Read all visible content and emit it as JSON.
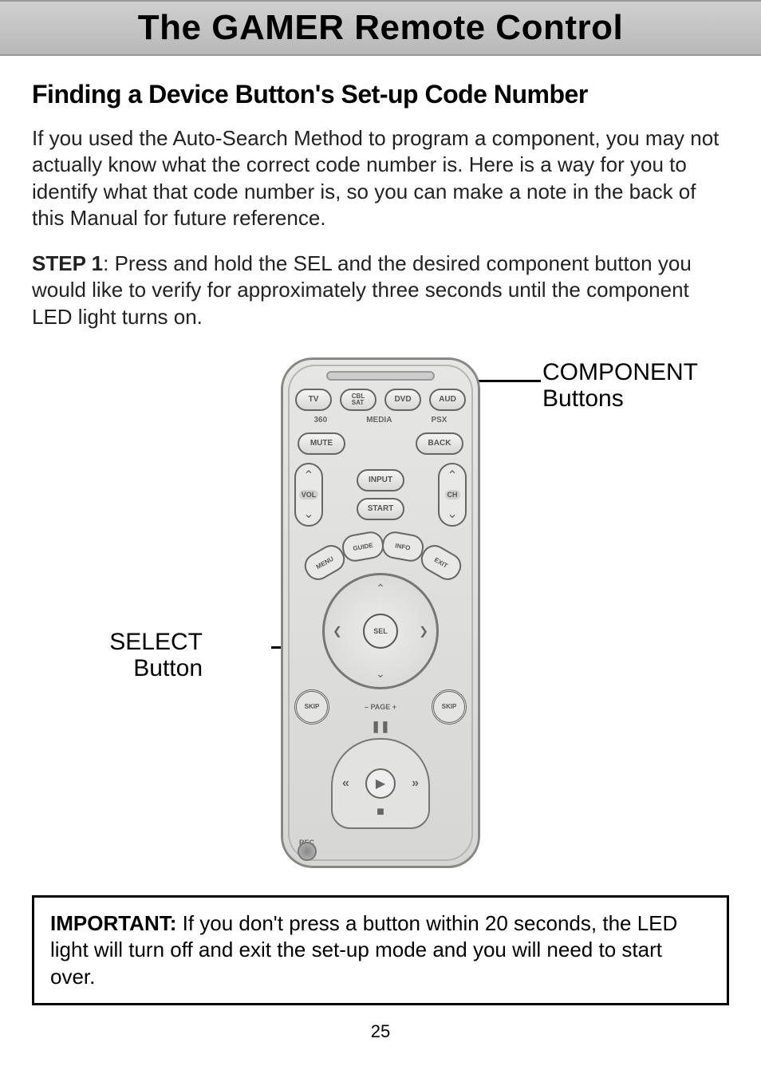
{
  "header": {
    "title": "The GAMER Remote Control"
  },
  "section": {
    "heading": "Finding a Device Button's Set-up Code Number"
  },
  "intro": "If you used the Auto-Search Method to program a component, you may not actually know what the correct code number is. Here is a way for you to identify what that code number is, so you can make a note in the back of this Manual for future reference.",
  "step1": {
    "label": "STEP 1",
    "text": ": Press and hold the SEL and the desired component button you would like to verify for approximately three seconds until the component LED light turns on."
  },
  "callouts": {
    "component_line1": "COMPONENT",
    "component_line2": "Buttons",
    "select_line1": "SELECT",
    "select_line2": "Button"
  },
  "remote": {
    "row1": [
      "TV",
      "CBL SAT",
      "DVD",
      "AUD"
    ],
    "sub1": [
      "360",
      "MEDIA",
      "PSX"
    ],
    "row2": [
      "MUTE",
      "BACK"
    ],
    "center_btns": [
      "INPUT",
      "START"
    ],
    "rocker_left": "VOL",
    "rocker_right": "CH",
    "arc": [
      "MENU",
      "GUIDE",
      "INFO",
      "EXIT"
    ],
    "sel": "SEL",
    "skip_minus": "SKIP",
    "skip_plus": "SKIP",
    "page": "– PAGE +",
    "rec": "REC"
  },
  "important": {
    "label": "IMPORTANT:",
    "text": " If you don't press a button within 20 seconds, the LED light will turn off and exit the set-up mode and you will need to start over."
  },
  "page_number": "25"
}
